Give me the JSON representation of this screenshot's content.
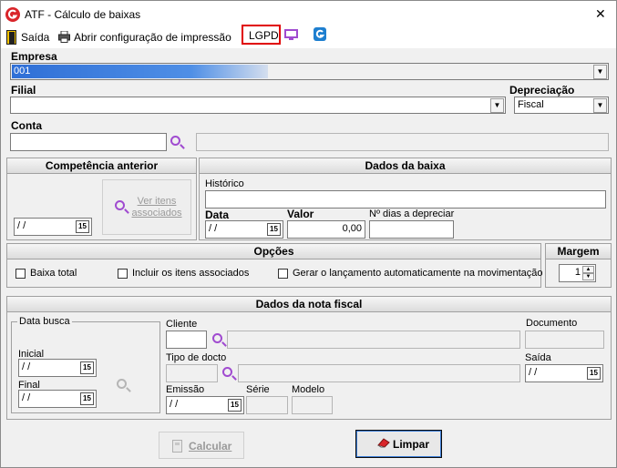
{
  "window": {
    "title": "ATF - Cálculo de baixas",
    "close_glyph": "✕"
  },
  "toolbar": {
    "exit_label": "Saída",
    "print_config_label": "Abrir configuração de impressão",
    "lgpd_label": "LGPD"
  },
  "company": {
    "label": "Empresa",
    "value": "001"
  },
  "branch": {
    "label": "Filial",
    "value": ""
  },
  "depreciation": {
    "label": "Depreciação",
    "value": "Fiscal"
  },
  "account": {
    "label": "Conta",
    "value": ""
  },
  "previous_competence": {
    "title": "Competência anterior",
    "view_items_label": "Ver itens associados",
    "date_value": "/ /"
  },
  "write_off": {
    "title": "Dados da baixa",
    "history_label": "Histórico",
    "history_value": "",
    "date_label": "Data",
    "date_value": "/ /",
    "amount_label": "Valor",
    "amount_value": "0,00",
    "days_label": "Nº dias a depreciar",
    "days_value": ""
  },
  "options": {
    "title": "Opções",
    "total_writeoff_label": "Baixa total",
    "include_items_label": "Incluir os itens associados",
    "generate_entry_label": "Gerar o lançamento automaticamente na movimentação"
  },
  "margin": {
    "title": "Margem",
    "value": "1"
  },
  "invoice": {
    "title": "Dados da nota fiscal",
    "search_date_label": "Data busca",
    "initial_label": "Inicial",
    "initial_value": "/ /",
    "final_label": "Final",
    "final_value": "/ /",
    "client_label": "Cliente",
    "document_label": "Documento",
    "doc_type_label": "Tipo de docto",
    "exit_label": "Saída",
    "exit_value": "/ /",
    "issue_label": "Emissão",
    "issue_value": "/ /",
    "series_label": "Série",
    "model_label": "Modelo"
  },
  "actions": {
    "calculate_label": "Calcular",
    "clear_label": "Limpar"
  },
  "calendar_glyph": "15",
  "colors": {
    "accent_purple": "#a04bd0",
    "lgpd_border": "#e00000",
    "selection_blue": "#3f7fdc",
    "brand_red": "#d9252a",
    "brand_blue": "#1e7fd0"
  }
}
